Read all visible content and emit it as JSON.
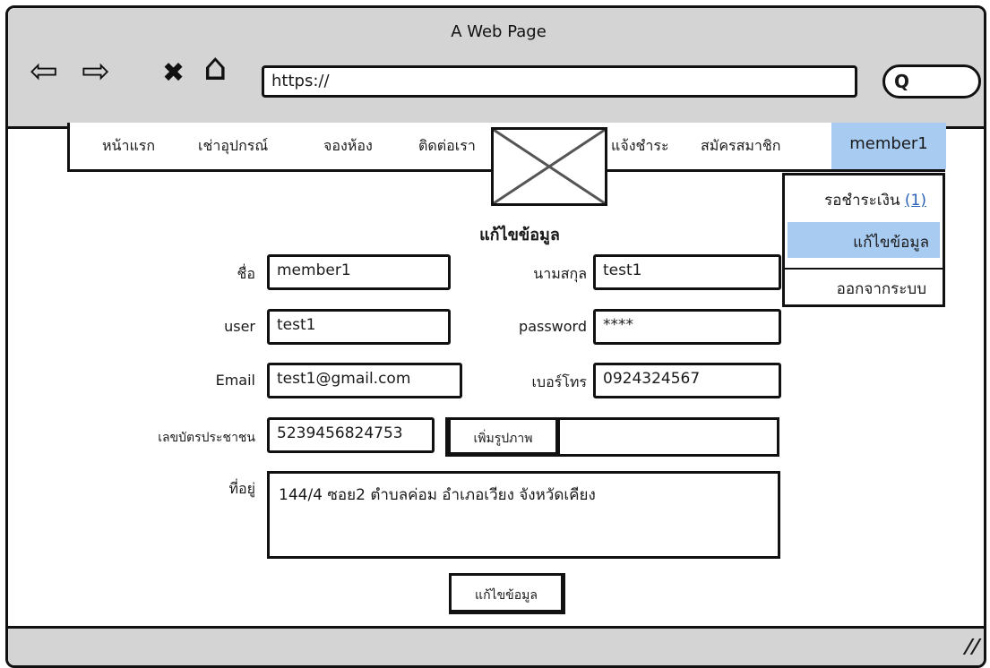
{
  "window": {
    "title": "A Web Page"
  },
  "browser": {
    "back_icon": "⇦",
    "forward_icon": "⇨",
    "stop_icon": "✖",
    "home_icon": "⌂",
    "url": "https://",
    "search_glyph": "Q"
  },
  "nav": {
    "items": [
      {
        "label": "หน้าแรก"
      },
      {
        "label": "เช่าอุปกรณ์"
      },
      {
        "label": "จองห้อง"
      },
      {
        "label": "ติดต่อเรา"
      },
      {
        "label": "แจ้งชำระ"
      },
      {
        "label": "สมัครสมาชิก"
      }
    ],
    "member": "member1"
  },
  "dropdown": {
    "pending_label": "รอชำระเงิน",
    "pending_count": "(1)",
    "edit_label": "แก้ไขข้อมูล",
    "logout_label": "ออกจากระบบ"
  },
  "form": {
    "heading": "แก้ไขข้อมูล",
    "first_name_label": "ชื่อ",
    "first_name": "member1",
    "last_name_label": "นามสกุล",
    "last_name": "test1",
    "user_label": "user",
    "user": "test1",
    "password_label": "password",
    "password": "****",
    "email_label": "Email",
    "email": "test1@gmail.com",
    "phone_label": "เบอร์โทร",
    "phone": "0924324567",
    "id_label": "เลขบัตรประชาชน",
    "id_number": "5239456824753",
    "add_image_label": "เพิ่มรูปภาพ",
    "address_label": "ที่อยู่",
    "address": "144/4 ซอย2 ตำบลค่อม อำเภอเวียง จังหวัดเคียง",
    "submit_label": "แก้ไขข้อมูล"
  },
  "colors": {
    "chrome": "#d4d4d4",
    "highlight": "#a8cbf2",
    "link": "#2a62b8"
  }
}
